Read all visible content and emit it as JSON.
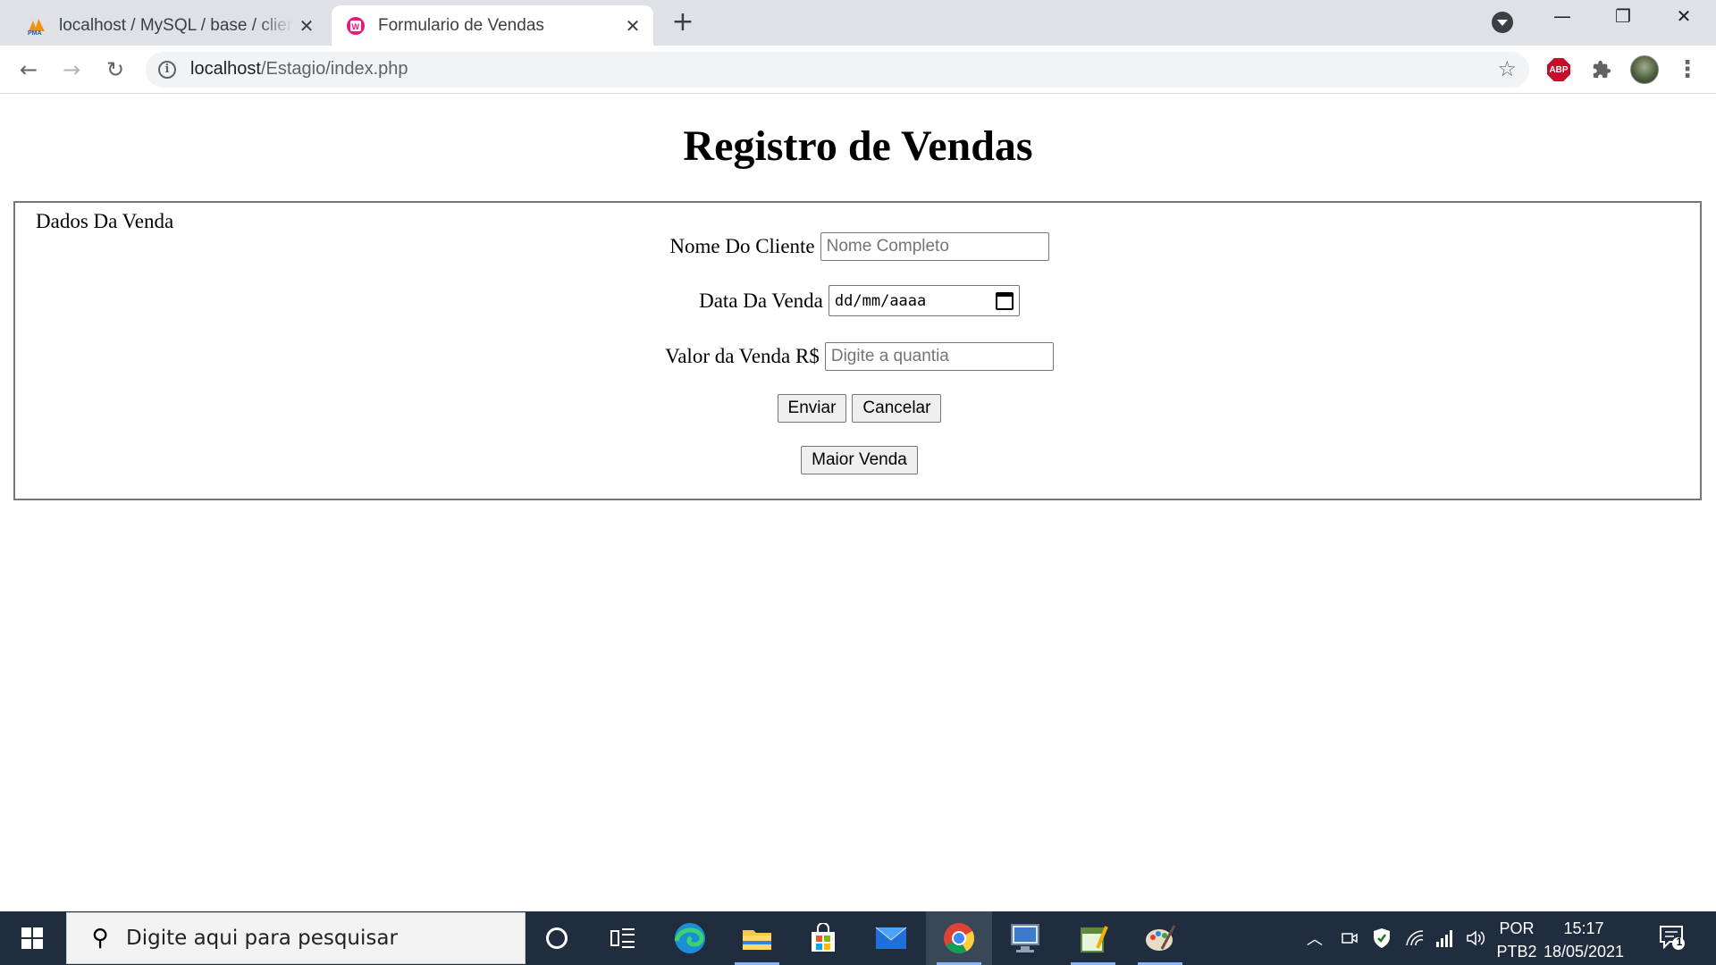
{
  "browser": {
    "tabs": [
      {
        "title": "localhost / MySQL / base / cliente",
        "active": false
      },
      {
        "title": "Formulario de Vendas",
        "active": true
      }
    ],
    "new_tab_label": "+",
    "url_host": "localhost",
    "url_path": "/Estagio/index.php",
    "window_controls": {
      "minimize": "—",
      "restore": "❐",
      "close": "✕"
    },
    "extension_abp_label": "ABP"
  },
  "page": {
    "title": "Registro de Vendas",
    "legend": "Dados Da Venda",
    "fields": {
      "nome_label": "Nome Do Cliente",
      "nome_placeholder": "Nome Completo",
      "data_label": "Data Da Venda",
      "data_value": "dd/mm/aaaa",
      "valor_label": "Valor da Venda R$",
      "valor_placeholder": "Digite a quantia"
    },
    "buttons": {
      "enviar": "Enviar",
      "cancelar": "Cancelar",
      "maior_venda": "Maior Venda"
    }
  },
  "taskbar": {
    "search_placeholder": "Digite aqui para pesquisar",
    "language": "POR",
    "keyboard": "PTB2",
    "time": "15:17",
    "date": "18/05/2021",
    "notification_count": "1",
    "pinned_apps": [
      "cortana-icon",
      "task-view-icon",
      "edge-icon",
      "file-explorer-icon",
      "store-icon",
      "mail-icon",
      "chrome-icon",
      "remote-desktop-icon",
      "notepad-icon",
      "paint-icon"
    ]
  }
}
